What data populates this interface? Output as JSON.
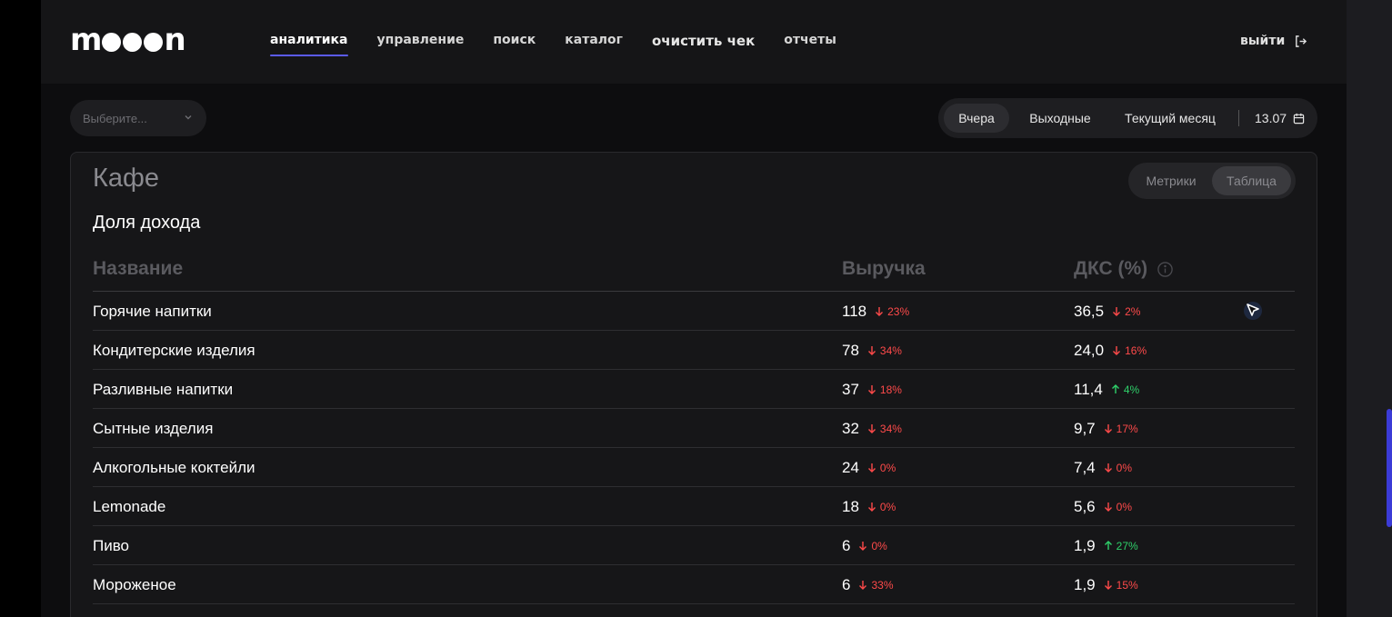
{
  "header": {
    "logo": "mooon",
    "nav": [
      {
        "label": "аналитика",
        "active": true
      },
      {
        "label": "управление"
      },
      {
        "label": "поиск"
      },
      {
        "label": "каталог"
      },
      {
        "label": "очистить чек"
      },
      {
        "label": "отчеты"
      }
    ],
    "logout_label": "выйти",
    "logout_icon": "logout-icon"
  },
  "filters": {
    "select_placeholder": "Выберите...",
    "periods": [
      "Вчера",
      "Выходные",
      "Текущий месяц"
    ],
    "active_period": "Вчера",
    "date": "13.07",
    "date_icon": "calendar-icon"
  },
  "card": {
    "title": "Кафе",
    "view_toggle": [
      "Метрики",
      "Таблица"
    ],
    "active_view": "Таблица",
    "subtitle": "Доля дохода",
    "columns": [
      "Название",
      "Выручка",
      "ДКС (%)"
    ],
    "info_icon": "info-icon",
    "rows": [
      {
        "name": "Горячие напитки",
        "revenue": "118",
        "revenue_delta": "23%",
        "revenue_dir": "down",
        "dks": "36,5",
        "dks_delta": "2%",
        "dks_dir": "down"
      },
      {
        "name": "Кондитерские изделия",
        "revenue": "78",
        "revenue_delta": "34%",
        "revenue_dir": "down",
        "dks": "24,0",
        "dks_delta": "16%",
        "dks_dir": "down"
      },
      {
        "name": "Разливные напитки",
        "revenue": "37",
        "revenue_delta": "18%",
        "revenue_dir": "down",
        "dks": "11,4",
        "dks_delta": "4%",
        "dks_dir": "up"
      },
      {
        "name": "Сытные изделия",
        "revenue": "32",
        "revenue_delta": "34%",
        "revenue_dir": "down",
        "dks": "9,7",
        "dks_delta": "17%",
        "dks_dir": "down"
      },
      {
        "name": "Алкогольные коктейли",
        "revenue": "24",
        "revenue_delta": "0%",
        "revenue_dir": "down",
        "dks": "7,4",
        "dks_delta": "0%",
        "dks_dir": "down"
      },
      {
        "name": "Lemonade",
        "revenue": "18",
        "revenue_delta": "0%",
        "revenue_dir": "down",
        "dks": "5,6",
        "dks_delta": "0%",
        "dks_dir": "down"
      },
      {
        "name": "Пиво",
        "revenue": "6",
        "revenue_delta": "0%",
        "revenue_dir": "down",
        "dks": "1,9",
        "dks_delta": "27%",
        "dks_dir": "up"
      },
      {
        "name": "Мороженое",
        "revenue": "6",
        "revenue_delta": "33%",
        "revenue_dir": "down",
        "dks": "1,9",
        "dks_delta": "15%",
        "dks_dir": "down"
      }
    ]
  },
  "colors": {
    "accent": "#5b5bf0",
    "down": "#ff4a4a",
    "up": "#2fd06a"
  }
}
